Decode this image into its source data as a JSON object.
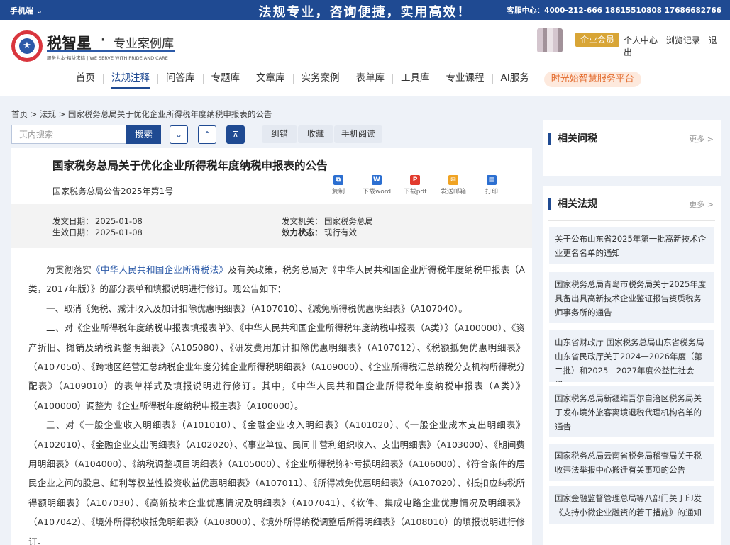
{
  "topbar": {
    "mobile_label": "手机端",
    "slogan": "法规专业，咨询便捷，实用高效！",
    "hotline": "客服中心：4000-212-666 18615510808 17686682766"
  },
  "header": {
    "brand": "税智星",
    "dot": "·",
    "subbrand": "专业案例库",
    "tagline": "服务为本·精益求精 | WE SERVE WITH PRIDE AND CARE",
    "vip_label": "企业会员",
    "links": [
      "个人中心",
      "浏览记录",
      "退出"
    ]
  },
  "nav": {
    "items": [
      "首页",
      "法规注释",
      "问答库",
      "专题库",
      "文章库",
      "实务案例",
      "表单库",
      "工具库",
      "专业课程",
      "AI服务"
    ],
    "active_index": 1,
    "platform": "时光始智慧服务平台"
  },
  "breadcrumb": "首页 > 法规 > 国家税务总局关于优化企业所得税年度纳税申报表的公告",
  "toolbar": {
    "search_placeholder": "页内搜索",
    "search_label": "搜索",
    "down_icon": "chevron-down-icon",
    "up_icon": "chevron-up-icon",
    "top_icon": "to-top-icon",
    "buttons": [
      "纠错",
      "收藏",
      "手机阅读"
    ]
  },
  "document": {
    "title": "国家税务总局关于优化企业所得税年度纳税申报表的公告",
    "number": "国家税务总局公告2025年第1号",
    "actions": [
      {
        "label": "复制",
        "icon": "copy-icon",
        "color": "#2c6fd1"
      },
      {
        "label": "下载word",
        "icon": "word-icon",
        "color": "#2c6fd1"
      },
      {
        "label": "下载pdf",
        "icon": "pdf-icon",
        "color": "#e23b2e"
      },
      {
        "label": "发送邮箱",
        "icon": "mail-icon",
        "color": "#f0a323"
      },
      {
        "label": "打印",
        "icon": "print-icon",
        "color": "#2c6fd1"
      }
    ],
    "meta": {
      "issue_date_label": "发文日期：",
      "issue_date": "2025-01-08",
      "effective_date_label": "生效日期：",
      "effective_date": "2025-01-08",
      "issuer_label": "发文机关：",
      "issuer": "国家税务总局",
      "status_label": "效力状态：",
      "status": "现行有效"
    },
    "body": {
      "p1_a": "为贯彻落实",
      "p1_link": "《中华人民共和国企业所得税法》",
      "p1_b": "及有关政策，税务总局对《中华人民共和国企业所得税年度纳税申报表（A类，2017年版）》的部分表单和填报说明进行修订。现公告如下：",
      "p2": "一、取消《免税、减计收入及加计扣除优惠明细表》（A107010）、《减免所得税优惠明细表》（A107040）。",
      "p3": "二、对《企业所得税年度纳税申报表填报表单》、《中华人民共和国企业所得税年度纳税申报表（A类）》（A100000）、《资产折旧、摊销及纳税调整明细表》（A105080）、《研发费用加计扣除优惠明细表》（A107012）、《税额抵免优惠明细表》（A107050）、《跨地区经营汇总纳税企业年度分摊企业所得税明细表》（A109000）、《企业所得税汇总纳税分支机构所得税分配表》（A109010）的表单样式及填报说明进行修订。其中，《中华人民共和国企业所得税年度纳税申报表（A类）》（A100000）调整为《企业所得税年度纳税申报主表》（A100000）。",
      "p4": "三、对《一般企业收入明细表》（A101010）、《金融企业收入明细表》（A101020）、《一般企业成本支出明细表》（A102010）、《金融企业支出明细表》（A102020）、《事业单位、民间非营利组织收入、支出明细表》（A103000）、《期间费用明细表》（A104000）、《纳税调整项目明细表》（A105000）、《企业所得税弥补亏损明细表》（A106000）、《符合条件的居民企业之间的股息、红利等权益性投资收益优惠明细表》（A107011）、《所得减免优惠明细表》（A107020）、《抵扣应纳税所得额明细表》（A107030）、《高新技术企业优惠情况及明细表》（A107041）、《软件、集成电路企业优惠情况及明细表》（A107042）、《境外所得税收抵免明细表》（A108000）、《境外所得纳税调整后所得明细表》（A108010）的填报说明进行修订。"
    }
  },
  "related_qa": {
    "title": "相关问税",
    "more": "更多 >"
  },
  "related_laws": {
    "title": "相关法规",
    "more": "更多 >",
    "items": [
      "关于公布山东省2025年第一批高新技术企业更名名单的通知",
      "国家税务总局青岛市税务局关于2025年度具备出具高新技术企业鉴证报告资质税务师事务所的通告",
      "山东省财政厅 国家税务总局山东省税务局 山东省民政厅关于2024—2026年度（第二批）和2025—2027年度公益性社会组...",
      "国家税务总局新疆维吾尔自治区税务局关于发布境外旅客离境退税代理机构名单的通告",
      "国家税务总局云南省税务局稽查局关于税收违法举报中心搬迁有关事项的公告",
      "国家金融监督管理总局等八部门关于印发《支持小微企业融资的若干措施》的通知"
    ]
  }
}
